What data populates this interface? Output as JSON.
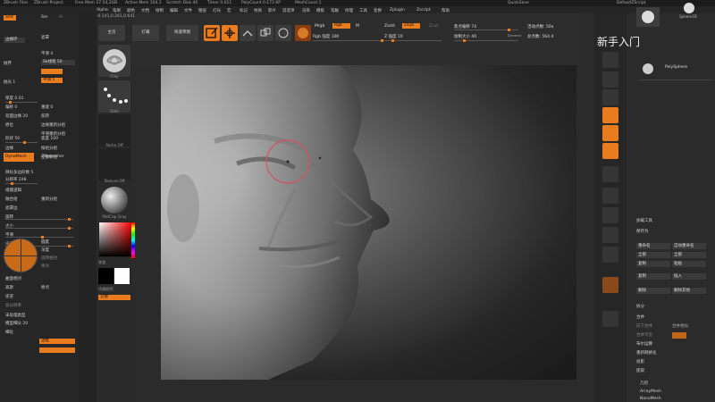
{
  "titlebar": {
    "items": [
      "ZBrush Files",
      "ZBrush Project",
      "Free Mem 27.54,2GB",
      "Active Mem 104.1",
      "Scratch Disk 40",
      "Timer 0.011",
      "PolyCount 0.173 KP",
      "MeshCount 1"
    ],
    "quicksave": "QuickSave",
    "right": "DefaultZScript"
  },
  "menubar": {
    "items": [
      "Alpha",
      "笔刷",
      "颜色",
      "文档",
      "绘制",
      "编辑",
      "文件",
      "图层",
      "灯光",
      "宏",
      "标记",
      "材质",
      "影片",
      "首选项",
      "渲染",
      "模板",
      "笔触",
      "纹理",
      "工具",
      "变换",
      "Zplugin",
      "Zscript",
      "帮助"
    ],
    "coords": "-0.141,0.261,0.641"
  },
  "left_panel": {
    "tabs": [
      "Smt",
      "Sm",
      "Ai"
    ],
    "rows": [
      "边缘环",
      "遮罩",
      "平滑 4",
      "Sk线程 50",
      "抛弃",
      "平滑 5",
      "抛光 1",
      "厚度 0.01",
      "偏移 0",
      "重建 0",
      "双面边缘 20",
      "反转",
      "原位",
      "边缘重新分组",
      "平滑重新分组",
      "形状 50",
      "弧度 100",
      "边缘",
      "按组分组",
      "新组",
      "全都新组"
    ],
    "dynamesh_label": "DynaMesh",
    "zremesher_label": "ZRemesher",
    "rows2": [
      "目标多边形数 5",
      "分辨率 248",
      "组输逻辑",
      "融合组",
      "重新分组",
      "遮罩边",
      "旋转",
      "大小",
      "平滑",
      "尖化",
      "圆度",
      "深度",
      "旋转相对",
      "绝对",
      "曲面相对",
      "高斯",
      "原点",
      "逆逆",
      "高分辨率",
      "平滑",
      "锁定网格",
      "曲面模式",
      "曲面"
    ],
    "bottom_rows": [
      "未处理类型",
      "模型细分 20",
      "细化",
      "边框"
    ]
  },
  "shelf": {
    "brush_label": "Clay",
    "stroke_label": "Dots",
    "alpha_label": "Alpha Off",
    "texture_label": "Texture Off",
    "material_label": "MatCap Gray",
    "gradient_label": "渐变",
    "switch_color_label": "切换颜色",
    "alternate_label": "交替"
  },
  "topbar": {
    "buttons": [
      "主页",
      "灯箱",
      "快速草图"
    ],
    "tools": [
      "编辑",
      "绘制",
      "移动",
      "缩放",
      "旋转"
    ],
    "mrgb": "Mrgb",
    "rgb": "Rgb",
    "m_label": "M",
    "zadd": "Zadd",
    "zsub": "Zsub",
    "zcut": "Zcut",
    "rgb_intensity": "Rgb 强度 100",
    "z_intensity": "Z 强度 10",
    "focal_shift": "焦点偏移 74",
    "draw_size": "绘制大小 40",
    "dynamic": "Dynamic",
    "active_points": "活动点数: 50a",
    "total_points": "总点数: 564.4"
  },
  "right_panel": {
    "subtool_thumbnails": [
      "Sphere3D",
      "PolySphere"
    ],
    "rows": [
      "加载工具",
      "保存为",
      "导入",
      "导出",
      "克隆",
      "全部",
      "Goz",
      "全部",
      "可见"
    ],
    "lower": [
      "重命名",
      "自动重命名",
      "全部",
      "全部",
      "复制",
      "粘贴",
      "复制",
      "插入",
      "删除",
      "删除其他",
      "全部删除",
      "拆分",
      "合并",
      "向下合并",
      "合并相似",
      "合并可见",
      "布尔运算",
      "重新网格化",
      "投影",
      "提取",
      "几何",
      "ArrayMesh",
      "NanoMesh"
    ],
    "polysphere_label": "PolySphere"
  },
  "overlay": {
    "tutorial_text": "新手入门"
  },
  "colors": {
    "accent": "#e87c1e",
    "panel": "#2b2b2b",
    "bg": "#1a1a1a"
  }
}
